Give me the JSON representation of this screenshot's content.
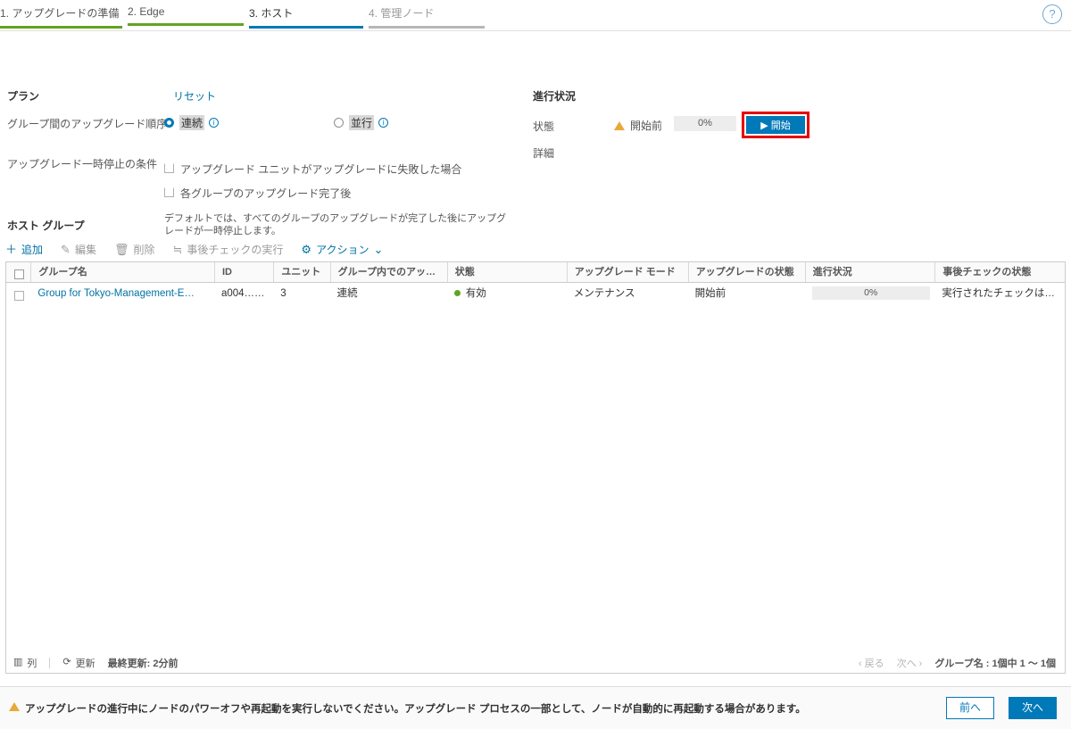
{
  "wizard": {
    "tabs": [
      {
        "label": "1. アップグレードの準備",
        "state": "done"
      },
      {
        "label": "2. Edge",
        "state": "done"
      },
      {
        "label": "3. ホスト",
        "state": "active"
      },
      {
        "label": "4. 管理ノード",
        "state": "upcoming"
      }
    ],
    "help_icon": "?"
  },
  "plan": {
    "title": "プラン",
    "reset_label": "リセット",
    "order_label": "グループ間のアップグレード順序",
    "options": [
      {
        "label": "連続",
        "selected": true,
        "info": "i"
      },
      {
        "label": "並行",
        "selected": false,
        "info": "i"
      }
    ],
    "pause_label": "アップグレード一時停止の条件",
    "pause_conditions": [
      {
        "label": "アップグレード ユニットがアップグレードに失敗した場合",
        "checked": false
      },
      {
        "label": "各グループのアップグレード完了後",
        "checked": false
      }
    ],
    "default_note": "デフォルトでは、すべてのグループのアップグレードが完了した後にアップグレードが一時停止します。"
  },
  "progress": {
    "title": "進行状況",
    "state_label": "状態",
    "state_value": "開始前",
    "state_percent": "0%",
    "detail_label": "詳細",
    "start_button": "▶ 開始",
    "start_highlight_color": "#e60000",
    "accent_color": "#0079b8",
    "warning_color": "#e8a93a"
  },
  "host_groups": {
    "title": "ホスト グループ",
    "toolbar": [
      {
        "label": "追加",
        "icon": "plus-icon",
        "glyph": "＋",
        "enabled": true
      },
      {
        "label": "編集",
        "icon": "pencil-icon",
        "glyph": "✎",
        "enabled": false
      },
      {
        "label": "削除",
        "icon": "trash-icon",
        "glyph": "🗑",
        "enabled": false
      },
      {
        "label": "事後チェックの実行",
        "icon": "checklist-icon",
        "glyph": "≒",
        "enabled": false
      },
      {
        "label": "アクション",
        "icon": "gear-icon",
        "glyph": "⚙",
        "enabled": true,
        "chevron": "⌄"
      }
    ],
    "columns": [
      "グループ名",
      "ID",
      "ユニット",
      "グループ内でのアップグレー…",
      "状態",
      "アップグレード モード",
      "アップグレードの状態",
      "進行状況",
      "事後チェックの状態"
    ],
    "rows": [
      {
        "selected": false,
        "name": "Group for Tokyo-Management-E…",
        "id": "a004……",
        "units": "3",
        "in_group_order": "連続",
        "state": "有効",
        "state_color": "#62a420",
        "mode": "メンテナンス",
        "upgrade_state": "開始前",
        "progress": "0%",
        "post_check_state": "実行されたチェックは…"
      }
    ],
    "footer": {
      "columns_label": "列",
      "columns_icon": "columns-icon",
      "refresh_label": "更新",
      "refresh_icon": "refresh-icon",
      "last_updated": "最終更新: 2分前",
      "prev_page": "‹ 戻る",
      "next_page": "次へ ›",
      "count": "グループ名 : 1個中 1 〜 1個"
    }
  },
  "bottom": {
    "warning": "アップグレードの進行中にノードのパワーオフや再起動を実行しないでください。アップグレード プロセスの一部として、ノードが自動的に再起動する場合があります。",
    "prev_button": "前へ",
    "next_button": "次へ"
  }
}
